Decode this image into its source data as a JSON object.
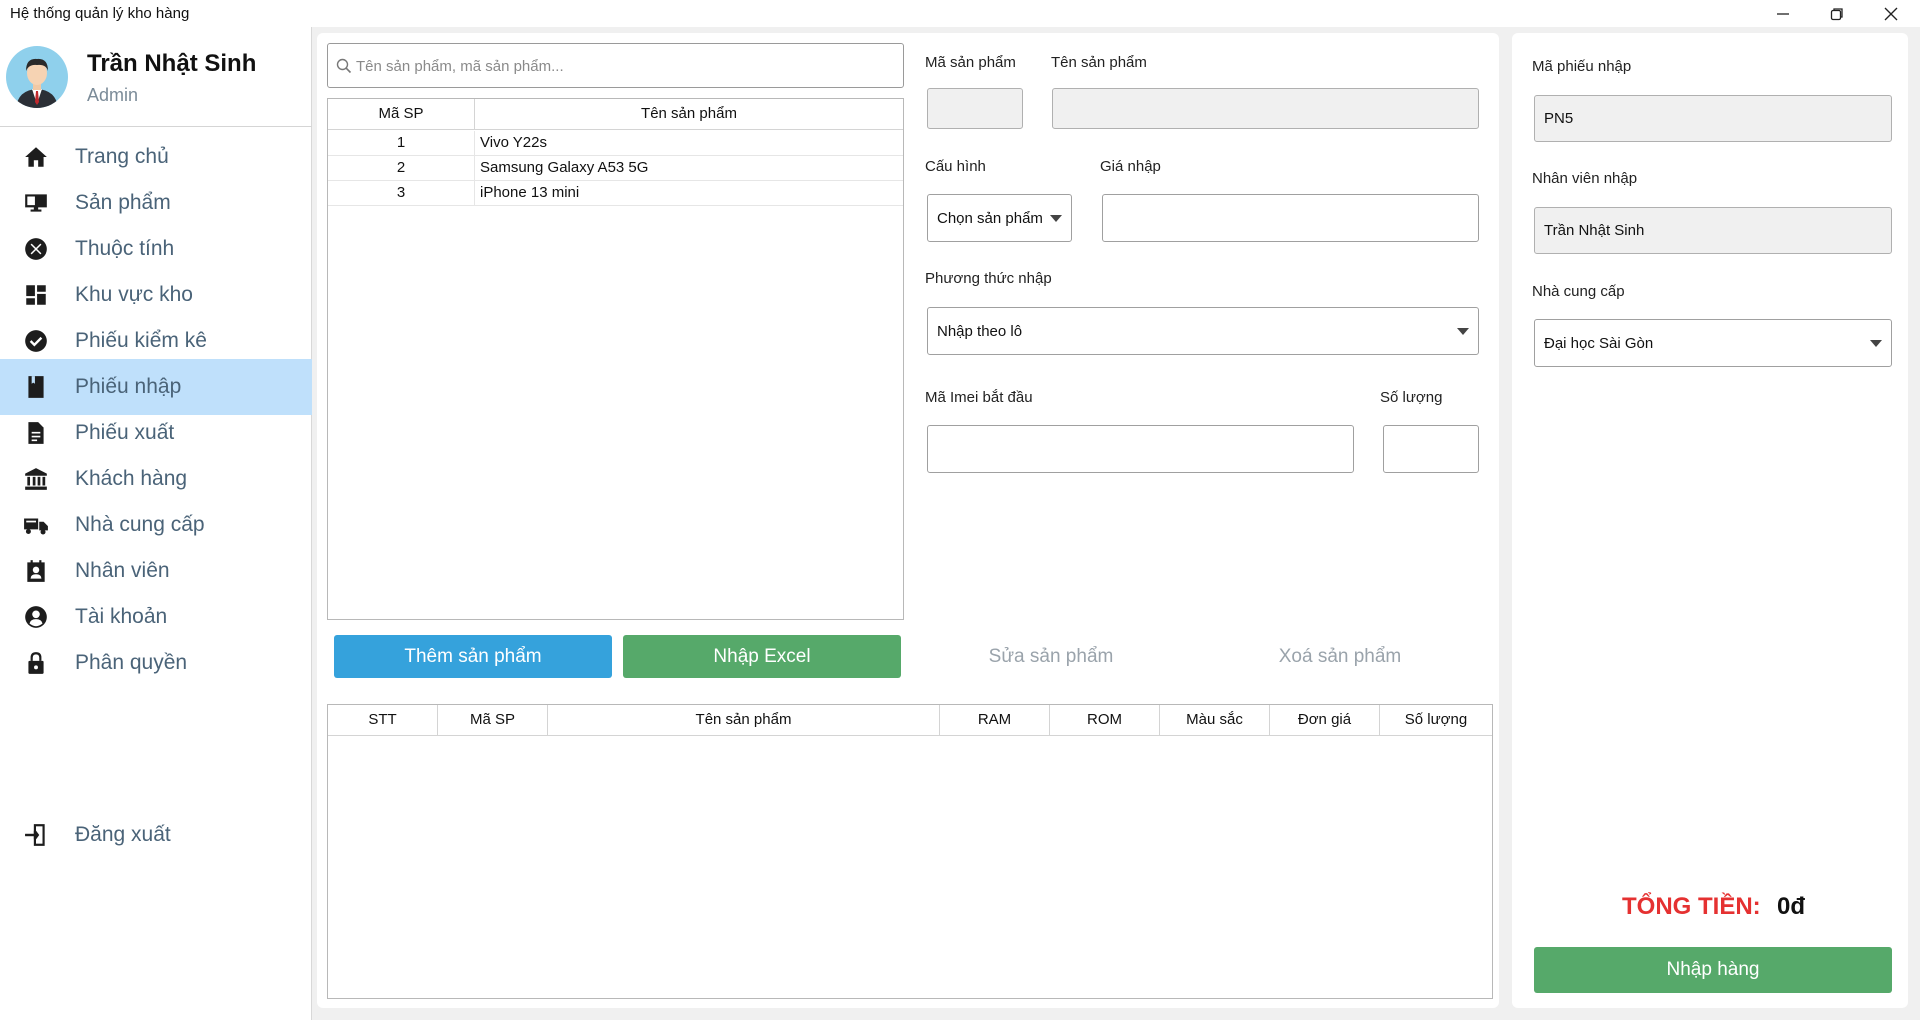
{
  "window": {
    "title": "Hệ thống quản lý kho hàng"
  },
  "user": {
    "name": "Trần Nhật Sinh",
    "role": "Admin"
  },
  "nav": {
    "items": [
      {
        "label": "Trang chủ",
        "icon": "home-icon"
      },
      {
        "label": "Sản phẩm",
        "icon": "product-icon"
      },
      {
        "label": "Thuộc tính",
        "icon": "attribute-icon"
      },
      {
        "label": "Khu vực kho",
        "icon": "dashboard-icon"
      },
      {
        "label": "Phiếu kiểm kê",
        "icon": "check-circle-icon"
      },
      {
        "label": "Phiếu nhập",
        "icon": "book-icon"
      },
      {
        "label": "Phiếu xuất",
        "icon": "document-icon"
      },
      {
        "label": "Khách hàng",
        "icon": "bank-icon"
      },
      {
        "label": "Nhà cung cấp",
        "icon": "truck-icon"
      },
      {
        "label": "Nhân viên",
        "icon": "badge-icon"
      },
      {
        "label": "Tài khoản",
        "icon": "account-icon"
      },
      {
        "label": "Phân quyền",
        "icon": "lock-icon"
      }
    ],
    "active": "Phiếu nhập",
    "logout": "Đăng xuất"
  },
  "search": {
    "placeholder": "Tên sản phẩm, mã sản phẩm..."
  },
  "product_table": {
    "headers": [
      "Mã SP",
      "Tên sản phẩm"
    ],
    "rows": [
      [
        "1",
        "Vivo Y22s"
      ],
      [
        "2",
        "Samsung Galaxy A53 5G"
      ],
      [
        "3",
        "iPhone 13 mini"
      ]
    ]
  },
  "form": {
    "product_code_label": "Mã sản phẩm",
    "product_name_label": "Tên sản phẩm",
    "config_label": "Cấu hình",
    "config_value": "Chọn sản phẩm",
    "price_label": "Giá nhập",
    "method_label": "Phương thức nhập",
    "method_value": "Nhập theo lô",
    "imei_label": "Mã Imei bắt đầu",
    "quantity_label": "Số lượng"
  },
  "actions": {
    "add": "Thêm sản phẩm",
    "excel": "Nhập Excel",
    "edit": "Sửa sản phẩm",
    "delete": "Xoá sản phẩm"
  },
  "detail_table": {
    "headers": [
      "STT",
      "Mã SP",
      "Tên sản phẩm",
      "RAM",
      "ROM",
      "Màu sắc",
      "Đơn giá",
      "Số lượng"
    ]
  },
  "receipt": {
    "code_label": "Mã phiếu nhập",
    "code_value": "PN5",
    "staff_label": "Nhân viên nhập",
    "staff_value": "Trần Nhật Sinh",
    "supplier_label": "Nhà cung cấp",
    "supplier_value": "Đại học Sài Gòn",
    "total_label": "TỔNG TIỀN:",
    "total_value": "0đ",
    "submit": "Nhập hàng"
  },
  "colors": {
    "active_nav": "#bfe0fb",
    "blue_button": "#35a2dc",
    "green_button": "#56a96a",
    "total_red": "#e53131"
  }
}
